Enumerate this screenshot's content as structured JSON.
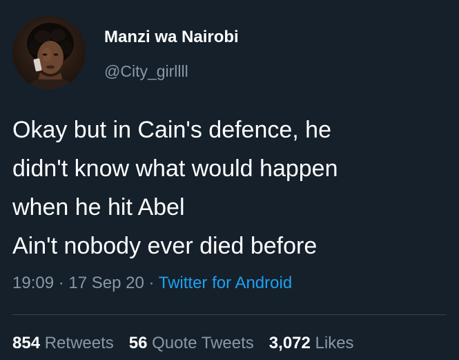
{
  "user": {
    "display_name": "Manzi wa Nairobi",
    "handle": "@City_girllll",
    "avatar_icon": "profile-photo-avatar"
  },
  "tweet": {
    "lines": [
      "Okay but in Cain's defence, he",
      "didn't know what would happen",
      "when he hit Abel",
      "Ain't nobody ever died before"
    ]
  },
  "meta": {
    "time": "19:09",
    "separator": "·",
    "date": "17 Sep 20",
    "source": "Twitter for Android"
  },
  "stats": {
    "retweets_count": "854",
    "retweets_label": "Retweets",
    "quotes_count": "56",
    "quotes_label": "Quote Tweets",
    "likes_count": "3,072",
    "likes_label": "Likes"
  },
  "colors": {
    "background": "#15202b",
    "primary_text": "#ffffff",
    "secondary_text": "#8899a6",
    "link": "#1da1f2",
    "divider": "#38444d"
  }
}
